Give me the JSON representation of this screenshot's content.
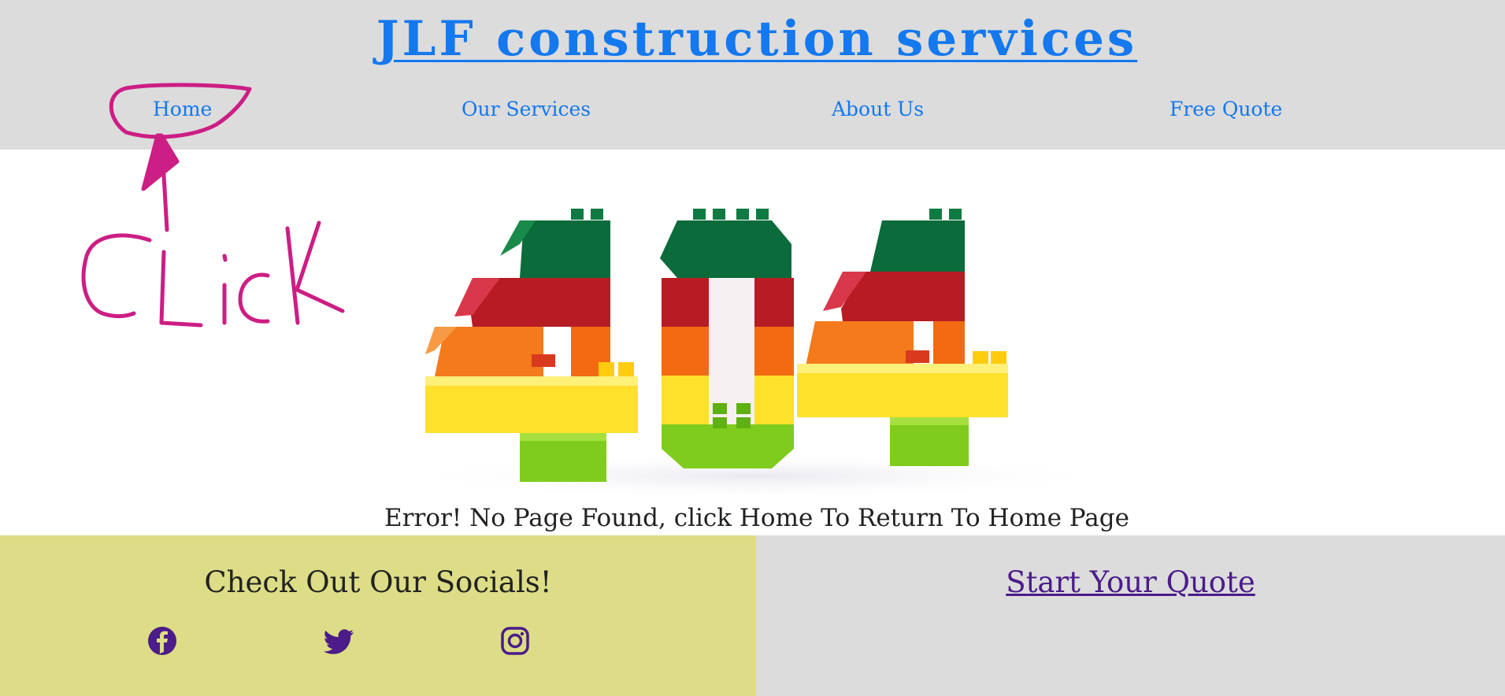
{
  "header": {
    "title": "JLF construction services",
    "nav": {
      "home": "Home",
      "services": "Our Services",
      "about": "About Us",
      "quote": "Free Quote"
    }
  },
  "main": {
    "hero_text": "404",
    "error_message": "Error! No Page Found, click Home To Return To Home Page",
    "annotation_text": "Click"
  },
  "footer": {
    "socials_heading": "Check Out Our Socials!",
    "social_icons": [
      "facebook-icon",
      "twitter-icon",
      "instagram-icon"
    ],
    "quote_link": "Start Your Quote"
  },
  "colors": {
    "header_bg": "#dcdcdc",
    "link_blue": "#1478ee",
    "footer_left_bg": "#dcdd86",
    "footer_right_bg": "#dcdcdc",
    "icon_purple": "#4b1c8a",
    "annotation_magenta": "#cc1e84"
  }
}
